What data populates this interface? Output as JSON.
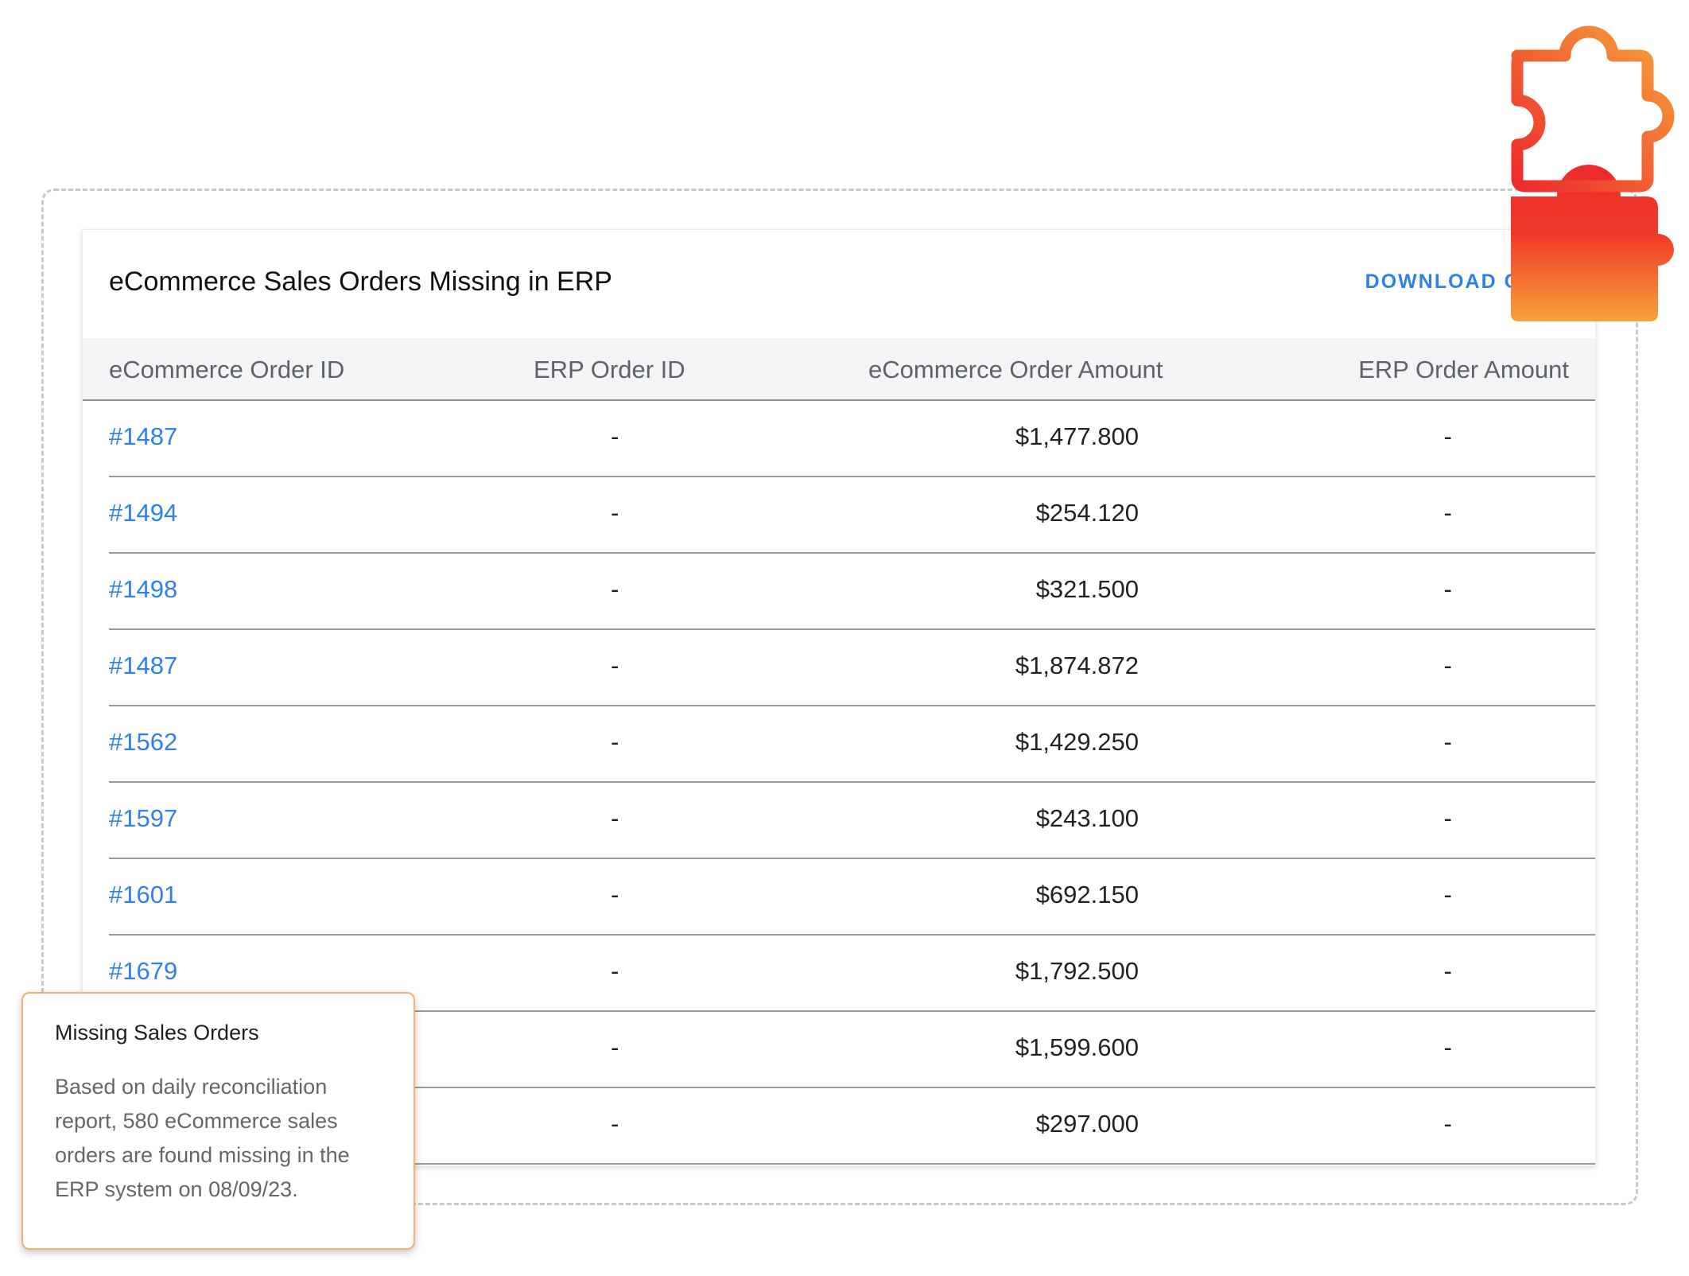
{
  "card": {
    "title": "eCommerce Sales Orders Missing in ERP",
    "download_label": "DOWNLOAD CSV"
  },
  "table": {
    "headers": [
      "eCommerce Order ID",
      "ERP Order ID",
      "eCommerce Order Amount",
      "ERP Order Amount"
    ],
    "rows": [
      {
        "ecom_id": "#1487",
        "erp_id": "-",
        "ecom_amount": "$1,477.800",
        "erp_amount": "-"
      },
      {
        "ecom_id": "#1494",
        "erp_id": "-",
        "ecom_amount": "$254.120",
        "erp_amount": "-"
      },
      {
        "ecom_id": "#1498",
        "erp_id": "-",
        "ecom_amount": "$321.500",
        "erp_amount": "-"
      },
      {
        "ecom_id": "#1487",
        "erp_id": "-",
        "ecom_amount": "$1,874.872",
        "erp_amount": "-"
      },
      {
        "ecom_id": "#1562",
        "erp_id": "-",
        "ecom_amount": "$1,429.250",
        "erp_amount": "-"
      },
      {
        "ecom_id": "#1597",
        "erp_id": "-",
        "ecom_amount": "$243.100",
        "erp_amount": "-"
      },
      {
        "ecom_id": "#1601",
        "erp_id": "-",
        "ecom_amount": "$692.150",
        "erp_amount": "-"
      },
      {
        "ecom_id": "#1679",
        "erp_id": "-",
        "ecom_amount": "$1,792.500",
        "erp_amount": "-"
      },
      {
        "ecom_id": "",
        "erp_id": "-",
        "ecom_amount": "$1,599.600",
        "erp_amount": "-"
      },
      {
        "ecom_id": "",
        "erp_id": "-",
        "ecom_amount": "$297.000",
        "erp_amount": "-"
      }
    ]
  },
  "tooltip": {
    "title": "Missing Sales Orders",
    "body": "Based on daily reconciliation report, 580 eCommerce sales orders are found missing in the ERP system on 08/09/23."
  },
  "icons": {
    "integration": "puzzle-icon"
  },
  "colors": {
    "link": "#2f80ed",
    "tooltip_border": "#f5b06a",
    "puzzle_gradient_start": "#f7a23a",
    "puzzle_gradient_mid": "#ec2b2b",
    "puzzle_gradient_end": "#f7a23a"
  }
}
